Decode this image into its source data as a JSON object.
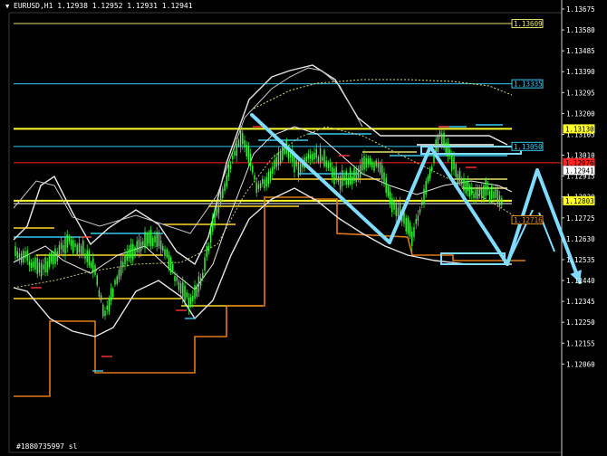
{
  "header": {
    "menu_icon": "triangle-down-icon",
    "title": "EURUSD,H1  1.12938 1.12952 1.12931 1.12941"
  },
  "footer": {
    "label": "#1880735997 sl"
  },
  "price_axis": {
    "ticks": [
      "1.13675",
      "1.13580",
      "1.13485",
      "1.13390",
      "1.13295",
      "1.13200",
      "1.13105",
      "1.13010",
      "1.12915",
      "1.12820",
      "1.12725",
      "1.12630",
      "1.12535",
      "1.12440",
      "1.12345",
      "1.12250",
      "1.12155",
      "1.12060"
    ]
  },
  "level_labels": [
    {
      "text": "1.13609",
      "color": "#e8e06a",
      "price": 1.13609
    },
    {
      "text": "1.13335",
      "color": "#37c8f0",
      "price": 1.13335
    },
    {
      "text": "1.13130",
      "color": "#ffff2a",
      "price": 1.1313
    },
    {
      "text": "1.13050",
      "color": "#37c8f0",
      "price": 1.1305
    },
    {
      "text": "1.12976",
      "color": "#ff2020",
      "price": 1.12976
    },
    {
      "text": "1.12941",
      "color": "#ffffff",
      "price": 1.12941
    },
    {
      "text": "1.12803",
      "color": "#ffff2a",
      "price": 1.12803
    },
    {
      "text": "1.12716",
      "color": "#e08a20",
      "price": 1.12716
    }
  ],
  "colors": {
    "background": "#000000",
    "candle": "#3cff3c",
    "bands": "#e6e6e6",
    "arrows": "#7fdcff",
    "support": "#ffd52a",
    "resistance": "#2aa8e0",
    "trail": "#e07a18",
    "ma_dotted": "#c8c86a"
  }
}
